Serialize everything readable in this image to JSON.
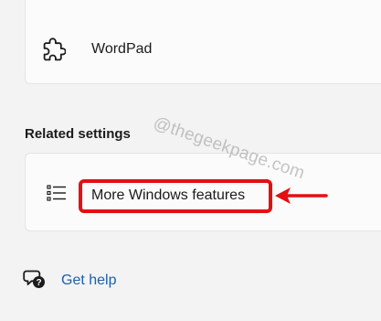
{
  "apps": {
    "wordpad": {
      "icon": "puzzle-icon",
      "label": "WordPad"
    }
  },
  "related_settings": {
    "title": "Related settings",
    "items": [
      {
        "icon": "list-icon",
        "label": "More Windows features"
      }
    ]
  },
  "help": {
    "icon": "help-chat-icon",
    "label": "Get help"
  },
  "annotation": {
    "highlight_color": "#e40f13",
    "arrow_icon": "red-arrow-icon"
  },
  "watermark": {
    "text": "@thegeekpage.com"
  }
}
